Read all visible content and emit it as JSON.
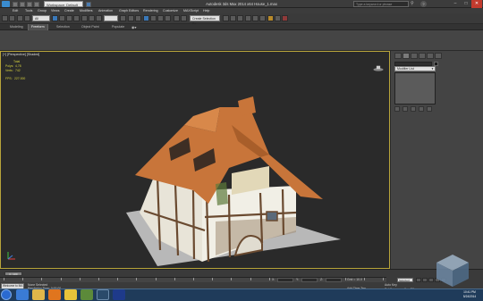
{
  "app": {
    "workspace": "Workspace: Default",
    "window_title": "Autodesk 3ds Max 2014 x64     House_1.max",
    "search_placeholder": "Type a keyword or phrase",
    "help_glyph": "?"
  },
  "menu": [
    "Edit",
    "Tools",
    "Group",
    "Views",
    "Create",
    "Modifiers",
    "Animation",
    "Graph Editors",
    "Rendering",
    "Customize",
    "MAXScript",
    "Help"
  ],
  "toolbar": {
    "selection_filter": "All",
    "create_selection_set": "Create Selection Se"
  },
  "ribbon": {
    "tabs": [
      "Modeling",
      "Freeform",
      "Selection",
      "Object Paint",
      "Populate"
    ],
    "active_tab_index": 1
  },
  "viewport": {
    "label": "[+] [Perspective] [Shaded]",
    "stats": [
      {
        "label": "Total",
        "value": ""
      },
      {
        "label": "Polys:",
        "value": "4,78"
      },
      {
        "label": "Verts:",
        "value": "742"
      }
    ],
    "fps_label": "FPS:",
    "fps_value": "227.000"
  },
  "command_panel": {
    "modifier_list": "Modifier List",
    "tabs": [
      "create-icon",
      "modify-icon",
      "hierarchy-icon",
      "motion-icon",
      "display-icon",
      "utilities-icon"
    ]
  },
  "timeline": {
    "slider_label": "0 / 100",
    "ticks": [
      0,
      5,
      10,
      15,
      20,
      25,
      30,
      35,
      40,
      45,
      50,
      55,
      60,
      65,
      70,
      75,
      80,
      85,
      90,
      95,
      100
    ]
  },
  "status": {
    "welcome": "Welcome to MA",
    "selection": "None Selected",
    "prompt": "Rendering Time: 0:00:00",
    "x_label": "X:",
    "y_label": "Y:",
    "z_label": "Z:",
    "grid": "Grid = 10.0",
    "add_time_tag": "Add Time Tag",
    "auto_key": "Auto Key",
    "selected": "Selected",
    "set_key": "Set Key",
    "key_filters": "Key Filters..."
  },
  "taskbar": {
    "apps": [
      "ie-icon",
      "explorer-icon",
      "media-player-icon",
      "chrome-icon",
      "app-icon",
      "3dsmax-icon",
      "photoshop-icon"
    ],
    "time": "10:41 PM",
    "date": "5/24/2014"
  },
  "colors": {
    "viewport_bg": "#2a2a2a",
    "viewport_border": "#b8a43a",
    "stats_text": "#d7d23e",
    "roof": "#c8753a",
    "taskbar": "#1f3b5a"
  }
}
